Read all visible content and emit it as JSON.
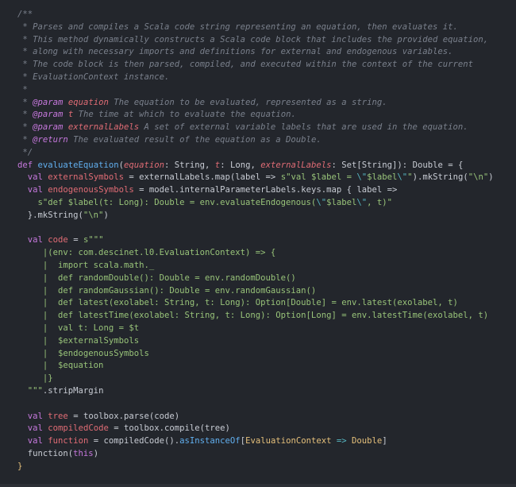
{
  "editor": {
    "language": "scala",
    "colors": {
      "background": "#23262c",
      "comment": "#7a808c",
      "keyword": "#c678dd",
      "function": "#61afef",
      "variable": "#e06c75",
      "type": "#e5c07b",
      "string": "#98c379",
      "escape": "#56b6c2"
    },
    "lines": [
      [
        {
          "t": "/**",
          "c": "comment"
        }
      ],
      [
        {
          "t": " * Parses and compiles a Scala code string representing an equation, then evaluates it.",
          "c": "comment"
        }
      ],
      [
        {
          "t": " * This method dynamically constructs a Scala code block that includes the provided equation,",
          "c": "comment"
        }
      ],
      [
        {
          "t": " * along with necessary imports and definitions for external and endogenous variables.",
          "c": "comment"
        }
      ],
      [
        {
          "t": " * The code block is then parsed, compiled, and executed within the context of the current",
          "c": "comment"
        }
      ],
      [
        {
          "t": " * EvaluationContext instance.",
          "c": "comment"
        }
      ],
      [
        {
          "t": " *",
          "c": "comment"
        }
      ],
      [
        {
          "t": " * ",
          "c": "comment"
        },
        {
          "t": "@param",
          "c": "c-tag"
        },
        {
          "t": " ",
          "c": "comment"
        },
        {
          "t": "equation",
          "c": "c-param"
        },
        {
          "t": " The equation to be evaluated, represented as a string.",
          "c": "comment"
        }
      ],
      [
        {
          "t": " * ",
          "c": "comment"
        },
        {
          "t": "@param",
          "c": "c-tag"
        },
        {
          "t": " ",
          "c": "comment"
        },
        {
          "t": "t",
          "c": "c-param"
        },
        {
          "t": " The time at which to evaluate the equation.",
          "c": "comment"
        }
      ],
      [
        {
          "t": " * ",
          "c": "comment"
        },
        {
          "t": "@param",
          "c": "c-tag"
        },
        {
          "t": " ",
          "c": "comment"
        },
        {
          "t": "externalLabels",
          "c": "c-param"
        },
        {
          "t": " A set of external variable labels that are used in the equation.",
          "c": "comment"
        }
      ],
      [
        {
          "t": " * ",
          "c": "comment"
        },
        {
          "t": "@return",
          "c": "c-tag"
        },
        {
          "t": " The evaluated result of the equation as a Double.",
          "c": "comment"
        }
      ],
      [
        {
          "t": " */",
          "c": "comment"
        }
      ],
      [
        {
          "t": "def",
          "c": "kw"
        },
        {
          "t": " ",
          "c": "plain"
        },
        {
          "t": "evaluateEquation",
          "c": "fn"
        },
        {
          "t": "(",
          "c": "plain"
        },
        {
          "t": "equation",
          "c": "param"
        },
        {
          "t": ": String, ",
          "c": "plain"
        },
        {
          "t": "t",
          "c": "param"
        },
        {
          "t": ": Long, ",
          "c": "plain"
        },
        {
          "t": "externalLabels",
          "c": "param"
        },
        {
          "t": ": Set[String]): Double = {",
          "c": "plain"
        }
      ],
      [
        {
          "t": "  ",
          "c": "plain"
        },
        {
          "t": "val",
          "c": "kw"
        },
        {
          "t": " ",
          "c": "plain"
        },
        {
          "t": "externalSymbols",
          "c": "var"
        },
        {
          "t": " = externalLabels.map(label => ",
          "c": "plain"
        },
        {
          "t": "s\"val $label = ",
          "c": "str"
        },
        {
          "t": "\\\"",
          "c": "esc"
        },
        {
          "t": "$label",
          "c": "str"
        },
        {
          "t": "\\\"",
          "c": "esc"
        },
        {
          "t": "\"",
          "c": "str"
        },
        {
          "t": ").mkString(",
          "c": "plain"
        },
        {
          "t": "\"\\n\"",
          "c": "str"
        },
        {
          "t": ")",
          "c": "plain"
        }
      ],
      [
        {
          "t": "  ",
          "c": "plain"
        },
        {
          "t": "val",
          "c": "kw"
        },
        {
          "t": " ",
          "c": "plain"
        },
        {
          "t": "endogenousSymbols",
          "c": "var"
        },
        {
          "t": " = model.internalParameterLabels.keys.map { label =>",
          "c": "plain"
        }
      ],
      [
        {
          "t": "    ",
          "c": "plain"
        },
        {
          "t": "s\"def $label(t: Long): Double = env.evaluateEndogenous(",
          "c": "str"
        },
        {
          "t": "\\\"",
          "c": "esc"
        },
        {
          "t": "$label",
          "c": "str"
        },
        {
          "t": "\\\"",
          "c": "esc"
        },
        {
          "t": ", t)\"",
          "c": "str"
        }
      ],
      [
        {
          "t": "  }.mkString(",
          "c": "plain"
        },
        {
          "t": "\"\\n\"",
          "c": "str"
        },
        {
          "t": ")",
          "c": "plain"
        }
      ],
      [
        {
          "t": "",
          "c": "plain"
        }
      ],
      [
        {
          "t": "  ",
          "c": "plain"
        },
        {
          "t": "val",
          "c": "kw"
        },
        {
          "t": " ",
          "c": "plain"
        },
        {
          "t": "code",
          "c": "var"
        },
        {
          "t": " = ",
          "c": "plain"
        },
        {
          "t": "s\"\"\"",
          "c": "str"
        }
      ],
      [
        {
          "t": "     ",
          "c": "plain"
        },
        {
          "t": "|",
          "c": "bar"
        },
        {
          "t": "(env: com.descinet.l0.EvaluationContext) => {",
          "c": "str"
        }
      ],
      [
        {
          "t": "     ",
          "c": "plain"
        },
        {
          "t": "|",
          "c": "bar"
        },
        {
          "t": "  import scala.math._",
          "c": "str"
        }
      ],
      [
        {
          "t": "     ",
          "c": "plain"
        },
        {
          "t": "|",
          "c": "bar"
        },
        {
          "t": "  def randomDouble(): Double = env.randomDouble()",
          "c": "str"
        }
      ],
      [
        {
          "t": "     ",
          "c": "plain"
        },
        {
          "t": "|",
          "c": "bar"
        },
        {
          "t": "  def randomGaussian(): Double = env.randomGaussian()",
          "c": "str"
        }
      ],
      [
        {
          "t": "     ",
          "c": "plain"
        },
        {
          "t": "|",
          "c": "bar"
        },
        {
          "t": "  def latest(exolabel: String, t: Long): Option[Double] = env.latest(exolabel, t)",
          "c": "str"
        }
      ],
      [
        {
          "t": "     ",
          "c": "plain"
        },
        {
          "t": "|",
          "c": "bar"
        },
        {
          "t": "  def latestTime(exolabel: String, t: Long): Option[Long] = env.latestTime(exolabel, t)",
          "c": "str"
        }
      ],
      [
        {
          "t": "     ",
          "c": "plain"
        },
        {
          "t": "|",
          "c": "bar"
        },
        {
          "t": "  val t: Long = $t",
          "c": "str"
        }
      ],
      [
        {
          "t": "     ",
          "c": "plain"
        },
        {
          "t": "|",
          "c": "bar"
        },
        {
          "t": "  $externalSymbols",
          "c": "str"
        }
      ],
      [
        {
          "t": "     ",
          "c": "plain"
        },
        {
          "t": "|",
          "c": "bar"
        },
        {
          "t": "  $endogenousSymbols",
          "c": "str"
        }
      ],
      [
        {
          "t": "     ",
          "c": "plain"
        },
        {
          "t": "|",
          "c": "bar"
        },
        {
          "t": "  $equation",
          "c": "str"
        }
      ],
      [
        {
          "t": "     ",
          "c": "plain"
        },
        {
          "t": "|",
          "c": "bar"
        },
        {
          "t": "}",
          "c": "str"
        }
      ],
      [
        {
          "t": "  ",
          "c": "plain"
        },
        {
          "t": "\"\"\"",
          "c": "str"
        },
        {
          "t": ".stripMargin",
          "c": "plain"
        }
      ],
      [
        {
          "t": "",
          "c": "plain"
        }
      ],
      [
        {
          "t": "  ",
          "c": "plain"
        },
        {
          "t": "val",
          "c": "kw"
        },
        {
          "t": " ",
          "c": "plain"
        },
        {
          "t": "tree",
          "c": "var"
        },
        {
          "t": " = toolbox.parse(code)",
          "c": "plain"
        }
      ],
      [
        {
          "t": "  ",
          "c": "plain"
        },
        {
          "t": "val",
          "c": "kw"
        },
        {
          "t": " ",
          "c": "plain"
        },
        {
          "t": "compiledCode",
          "c": "var"
        },
        {
          "t": " = toolbox.compile(tree)",
          "c": "plain"
        }
      ],
      [
        {
          "t": "  ",
          "c": "plain"
        },
        {
          "t": "val",
          "c": "kw"
        },
        {
          "t": " ",
          "c": "plain"
        },
        {
          "t": "function",
          "c": "var"
        },
        {
          "t": " = compiledCode().",
          "c": "plain"
        },
        {
          "t": "asInstanceOf",
          "c": "fn"
        },
        {
          "t": "[",
          "c": "plain"
        },
        {
          "t": "EvaluationContext",
          "c": "type"
        },
        {
          "t": " => ",
          "c": "op"
        },
        {
          "t": "Double",
          "c": "type"
        },
        {
          "t": "]",
          "c": "plain"
        }
      ],
      [
        {
          "t": "  function(",
          "c": "plain"
        },
        {
          "t": "this",
          "c": "kw"
        },
        {
          "t": ")",
          "c": "plain"
        }
      ],
      [
        {
          "t": "}",
          "c": "brace"
        }
      ]
    ]
  }
}
